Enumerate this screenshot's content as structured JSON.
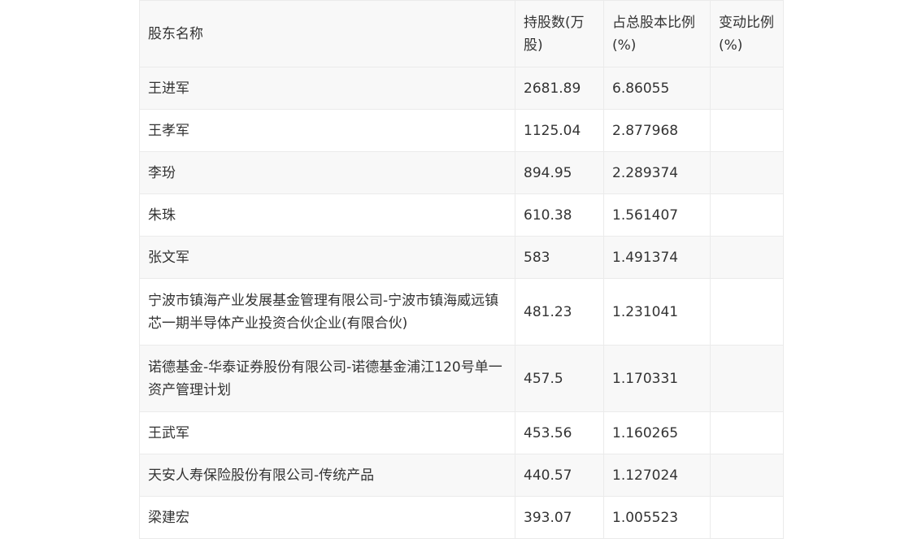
{
  "table": {
    "headers": [
      "股东名称",
      "持股数(万股)",
      "占总股本比例(%)",
      "变动比例(%)"
    ],
    "rows": [
      {
        "name": "王进军",
        "shares": "2681.89",
        "ratio": "6.86055",
        "change": ""
      },
      {
        "name": "王孝军",
        "shares": "1125.04",
        "ratio": "2.877968",
        "change": ""
      },
      {
        "name": "李玢",
        "shares": "894.95",
        "ratio": "2.289374",
        "change": ""
      },
      {
        "name": "朱珠",
        "shares": "610.38",
        "ratio": "1.561407",
        "change": ""
      },
      {
        "name": "张文军",
        "shares": "583",
        "ratio": "1.491374",
        "change": ""
      },
      {
        "name": "宁波市镇海产业发展基金管理有限公司-宁波市镇海威远镇芯一期半导体产业投资合伙企业(有限合伙)",
        "shares": "481.23",
        "ratio": "1.231041",
        "change": ""
      },
      {
        "name": "诺德基金-华泰证券股份有限公司-诺德基金浦江120号单一资产管理计划",
        "shares": "457.5",
        "ratio": "1.170331",
        "change": ""
      },
      {
        "name": "王武军",
        "shares": "453.56",
        "ratio": "1.160265",
        "change": ""
      },
      {
        "name": "天安人寿保险股份有限公司-传统产品",
        "shares": "440.57",
        "ratio": "1.127024",
        "change": ""
      },
      {
        "name": "梁建宏",
        "shares": "393.07",
        "ratio": "1.005523",
        "change": ""
      }
    ]
  }
}
